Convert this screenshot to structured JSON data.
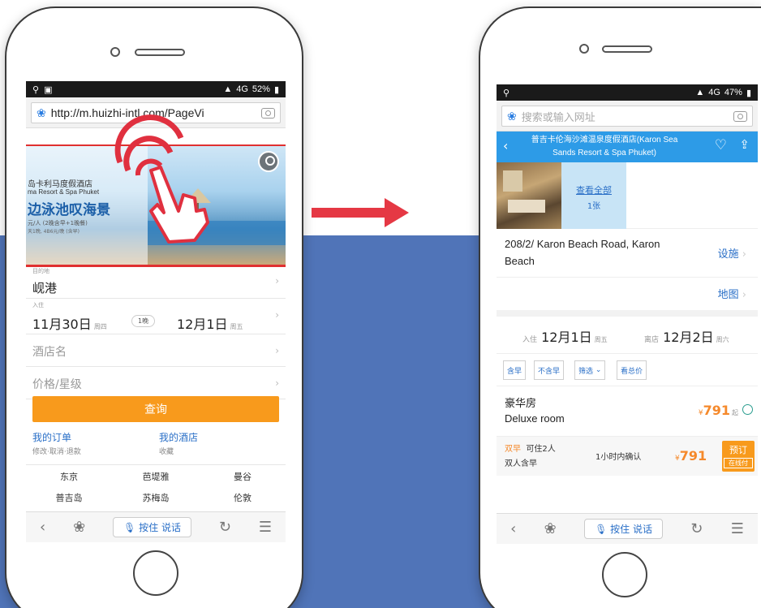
{
  "left_phone": {
    "status_bar": {
      "battery": "52%",
      "network": "4G"
    },
    "url": "http://m.huizhi-intl.com/PageVi",
    "banner": {
      "line1": "岛卡利马度假酒店",
      "line2": "ma Resort & Spa Phuket",
      "line3": "边泳池叹海景",
      "line4": "元/人 (2晚含早+1晚餐)",
      "line5": "天1晚, 4B6元/晚 (含早)"
    },
    "form": {
      "destination_label": "目的地",
      "destination": "岘港",
      "checkin_label": "入住",
      "checkin_date": "11月30日",
      "checkin_weekday": "周四",
      "nights": "1晚",
      "checkout_date": "12月1日",
      "checkout_weekday": "周五",
      "hotel_name_placeholder": "酒店名",
      "price_star_placeholder": "价格/星级",
      "query_button": "查询"
    },
    "links": [
      {
        "title": "我的订单",
        "sub": "修改·取消·退款"
      },
      {
        "title": "我的酒店",
        "sub": "收藏"
      }
    ],
    "cities": [
      "东京",
      "芭堤雅",
      "曼谷",
      "普吉岛",
      "苏梅岛",
      "伦敦"
    ],
    "toolbar": {
      "voice_label": "按住 说话"
    }
  },
  "right_phone": {
    "status_bar": {
      "battery": "47%",
      "network": "4G"
    },
    "search_placeholder": "搜索或输入网址",
    "hotel_title": "普吉卡伦海沙滩温泉度假酒店(Karon Sea Sands Resort & Spa Phuket)",
    "view_all": "查看全部",
    "photo_count": "1张",
    "address": "208/2/ Karon Beach Road, Karon Beach",
    "facilities_link": "设施",
    "map_link": "地图",
    "checkin_label": "入住",
    "checkin_date": "12月1日",
    "checkin_weekday": "周五",
    "checkout_label": "离店",
    "checkout_date": "12月2日",
    "checkout_weekday": "周六",
    "filters": [
      "含早",
      "不含早",
      "筛选",
      "看总价"
    ],
    "room": {
      "name_cn": "豪华房",
      "name_en": "Deluxe room",
      "price": "791",
      "currency": "¥",
      "suffix": "起"
    },
    "rate": {
      "breakfast": "双早",
      "capacity": "可住2人",
      "breakfast_detail": "双人含早",
      "confirm": "1小时内确认",
      "price": "791",
      "currency": "¥",
      "book_label": "预订",
      "pay_label": "在线付"
    },
    "toolbar": {
      "voice_label": "按住 说话"
    }
  },
  "colors": {
    "accent_orange": "#f89a1c",
    "header_blue": "#2d9be7",
    "arrow_red": "#e53844",
    "bg_blue": "#5074b8"
  }
}
